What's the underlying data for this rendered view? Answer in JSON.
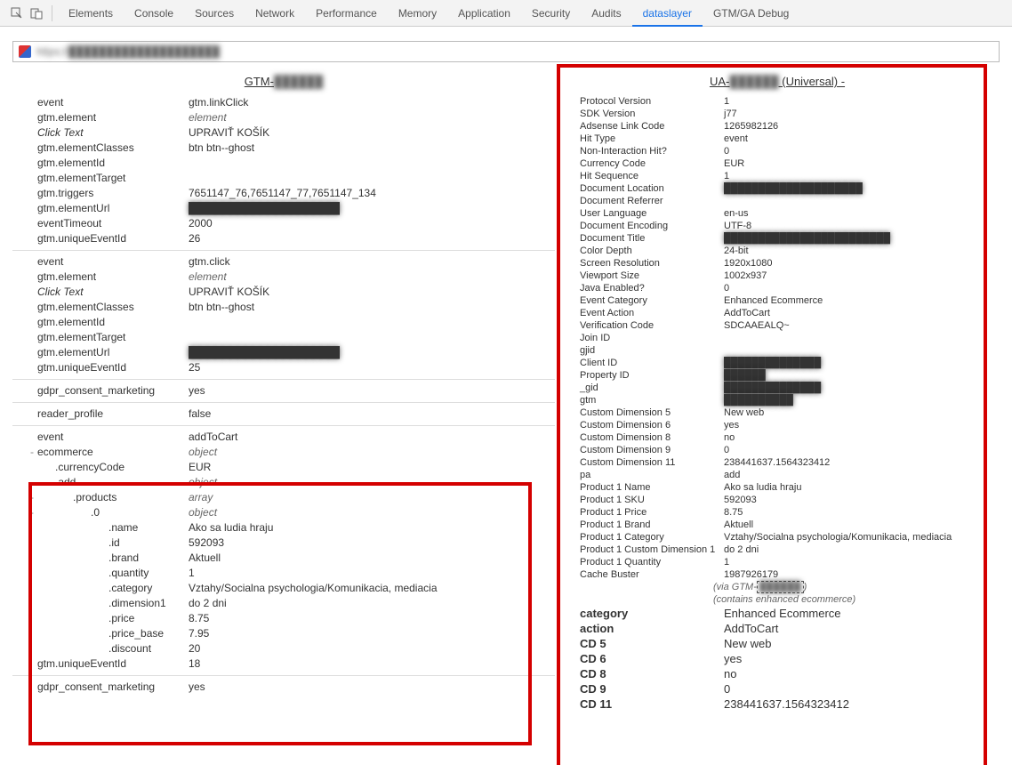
{
  "tabs": [
    "Elements",
    "Console",
    "Sources",
    "Network",
    "Performance",
    "Memory",
    "Application",
    "Security",
    "Audits",
    "dataslayer",
    "GTM/GA Debug"
  ],
  "active_tab": "dataslayer",
  "url_bar": "https://████████████████████",
  "left": {
    "heading": "GTM-██████",
    "group1": [
      {
        "k": "event",
        "v": "gtm.linkClick"
      },
      {
        "k": "gtm.element",
        "v": "element",
        "italic": true
      },
      {
        "k": "Click Text",
        "v": "UPRAVIŤ KOŠÍK",
        "kitalic": true
      },
      {
        "k": "gtm.elementClasses",
        "v": "btn btn--ghost"
      },
      {
        "k": "gtm.elementId",
        "v": ""
      },
      {
        "k": "gtm.elementTarget",
        "v": ""
      },
      {
        "k": "gtm.triggers",
        "v": "7651147_76,7651147_77,7651147_134"
      },
      {
        "k": "gtm.elementUrl",
        "v": "████████████████████",
        "blur": true
      },
      {
        "k": "eventTimeout",
        "v": "2000"
      },
      {
        "k": "gtm.uniqueEventId",
        "v": "26"
      }
    ],
    "group2": [
      {
        "k": "event",
        "v": "gtm.click"
      },
      {
        "k": "gtm.element",
        "v": "element",
        "italic": true
      },
      {
        "k": "Click Text",
        "v": "UPRAVIŤ KOŠÍK",
        "kitalic": true
      },
      {
        "k": "gtm.elementClasses",
        "v": "btn btn--ghost"
      },
      {
        "k": "gtm.elementId",
        "v": ""
      },
      {
        "k": "gtm.elementTarget",
        "v": ""
      },
      {
        "k": "gtm.elementUrl",
        "v": "████████████████████",
        "blur": true
      },
      {
        "k": "gtm.uniqueEventId",
        "v": "25"
      }
    ],
    "group3": [
      {
        "k": "gdpr_consent_marketing",
        "v": "yes"
      }
    ],
    "group4": [
      {
        "k": "reader_profile",
        "v": "false"
      }
    ],
    "group5": [
      {
        "k": "event",
        "v": "addToCart"
      },
      {
        "k": "ecommerce",
        "v": "object",
        "toggle": "-",
        "italic": true
      },
      {
        "k": ".currencyCode",
        "v": "EUR",
        "indent": 1
      },
      {
        "k": ".add",
        "v": "object",
        "indent": 1,
        "toggle": "-",
        "italic": true
      },
      {
        "k": ".products",
        "v": "array",
        "indent": 2,
        "toggle": "-",
        "italic": true
      },
      {
        "k": ".0",
        "v": "object",
        "indent": 3,
        "toggle": "-",
        "italic": true
      },
      {
        "k": ".name",
        "v": "Ako sa ludia hraju",
        "indent": 4
      },
      {
        "k": ".id",
        "v": "592093",
        "indent": 4
      },
      {
        "k": ".brand",
        "v": "Aktuell",
        "indent": 4
      },
      {
        "k": ".quantity",
        "v": "1",
        "indent": 4
      },
      {
        "k": ".category",
        "v": "Vztahy/Socialna psychologia/Komunikacia, mediacia",
        "indent": 4
      },
      {
        "k": ".dimension1",
        "v": "do 2 dni",
        "indent": 4
      },
      {
        "k": ".price",
        "v": "8.75",
        "indent": 4
      },
      {
        "k": ".price_base",
        "v": "7.95",
        "indent": 4
      },
      {
        "k": ".discount",
        "v": "20",
        "indent": 4
      },
      {
        "k": "gtm.uniqueEventId",
        "v": "18"
      }
    ],
    "group6": [
      {
        "k": "gdpr_consent_marketing",
        "v": "yes"
      }
    ]
  },
  "right": {
    "heading_pre": "UA-",
    "heading_blur": "██████",
    "heading_post": " (Universal)  -",
    "rows": [
      {
        "k": "Protocol Version",
        "v": "1"
      },
      {
        "k": "SDK Version",
        "v": "j77"
      },
      {
        "k": "Adsense Link Code",
        "v": "1265982126"
      },
      {
        "k": "Hit Type",
        "v": "event"
      },
      {
        "k": "Non-Interaction Hit?",
        "v": "0"
      },
      {
        "k": "Currency Code",
        "v": "EUR"
      },
      {
        "k": "Hit Sequence",
        "v": "1"
      },
      {
        "k": "Document Location",
        "v": "████████████████████",
        "blur": true
      },
      {
        "k": "Document Referrer",
        "v": ""
      },
      {
        "k": "User Language",
        "v": "en-us"
      },
      {
        "k": "Document Encoding",
        "v": "UTF-8"
      },
      {
        "k": "Document Title",
        "v": "████████████████████████",
        "blur": true
      },
      {
        "k": "Color Depth",
        "v": "24-bit"
      },
      {
        "k": "Screen Resolution",
        "v": "1920x1080"
      },
      {
        "k": "Viewport Size",
        "v": "1002x937"
      },
      {
        "k": "Java Enabled?",
        "v": "0"
      },
      {
        "k": "Event Category",
        "v": "Enhanced Ecommerce"
      },
      {
        "k": "Event Action",
        "v": "AddToCart"
      },
      {
        "k": "Verification Code",
        "v": "SDCAAEALQ~"
      },
      {
        "k": "Join ID",
        "v": ""
      },
      {
        "k": "gjid",
        "v": ""
      },
      {
        "k": "Client ID",
        "v": "██████████████",
        "blur": true
      },
      {
        "k": "Property ID",
        "v": "██████",
        "blur": true
      },
      {
        "k": "_gid",
        "v": "██████████████",
        "blur": true
      },
      {
        "k": "gtm",
        "v": "██████████",
        "blur": true
      },
      {
        "k": "Custom Dimension 5",
        "v": "New web"
      },
      {
        "k": "Custom Dimension 6",
        "v": "yes"
      },
      {
        "k": "Custom Dimension 8",
        "v": "no"
      },
      {
        "k": "Custom Dimension 9",
        "v": "0"
      },
      {
        "k": "Custom Dimension 11",
        "v": "238441637.1564323412"
      },
      {
        "k": "pa",
        "v": "add"
      },
      {
        "k": "Product 1 Name",
        "v": "Ako sa ludia hraju"
      },
      {
        "k": "Product 1 SKU",
        "v": "592093"
      },
      {
        "k": "Product 1 Price",
        "v": "8.75"
      },
      {
        "k": "Product 1 Brand",
        "v": "Aktuell"
      },
      {
        "k": "Product 1 Category",
        "v": "Vztahy/Socialna psychologia/Komunikacia, mediacia"
      },
      {
        "k": "Product 1 Custom Dimension 1",
        "v": "do 2 dni"
      },
      {
        "k": "Product 1 Quantity",
        "v": "1"
      },
      {
        "k": "Cache Buster",
        "v": "1987926179"
      }
    ],
    "via_pre": "(via GTM-",
    "via_blur": "██████",
    "via_post": ")",
    "contains": "(contains enhanced ecommerce)",
    "bigrows": [
      {
        "k": "category",
        "v": "Enhanced Ecommerce"
      },
      {
        "k": "action",
        "v": "AddToCart"
      },
      {
        "k": "CD 5",
        "v": "New web"
      },
      {
        "k": "CD 6",
        "v": "yes"
      },
      {
        "k": "CD 8",
        "v": "no"
      },
      {
        "k": "CD 9",
        "v": "0"
      },
      {
        "k": "CD 11",
        "v": "238441637.1564323412"
      }
    ]
  }
}
